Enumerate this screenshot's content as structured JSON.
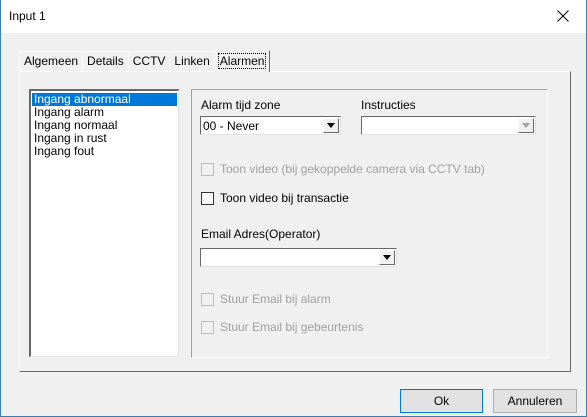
{
  "window": {
    "title": "Input 1"
  },
  "tabs": [
    {
      "label": "Algemeen"
    },
    {
      "label": "Details"
    },
    {
      "label": "CCTV"
    },
    {
      "label": "Linken"
    },
    {
      "label": "Alarmen"
    }
  ],
  "active_tab": "Alarmen",
  "list": {
    "items": [
      {
        "label": "Ingang abnormaal"
      },
      {
        "label": "Ingang alarm"
      },
      {
        "label": "Ingang normaal"
      },
      {
        "label": "Ingang in rust"
      },
      {
        "label": "Ingang fout"
      }
    ],
    "selected": "Ingang abnormaal"
  },
  "panel": {
    "alarm_zone_label": "Alarm tijd zone",
    "alarm_zone_value": "00 - Never",
    "instructions_label": "Instructies",
    "instructions_value": "",
    "show_video_linked": {
      "label": "Toon video (bij gekoppelde camera via CCTV tab)",
      "checked": false,
      "enabled": false
    },
    "show_video_transaction": {
      "label": "Toon video bij transactie",
      "checked": false,
      "enabled": true
    },
    "email_label": "Email Adres(Operator)",
    "email_value": "",
    "send_email_alarm": {
      "label": "Stuur Email bij alarm",
      "checked": false,
      "enabled": false
    },
    "send_email_event": {
      "label": "Stuur Email bij gebeurtenis",
      "checked": false,
      "enabled": false
    }
  },
  "buttons": {
    "ok": "Ok",
    "cancel": "Annuleren"
  },
  "icons": {
    "close": "close-icon",
    "dropdown": "chevron-down-icon"
  },
  "colors": {
    "selection": "#0078d7",
    "window_border": "#3c7fb1",
    "dialog_background": "#f0f0f0"
  }
}
